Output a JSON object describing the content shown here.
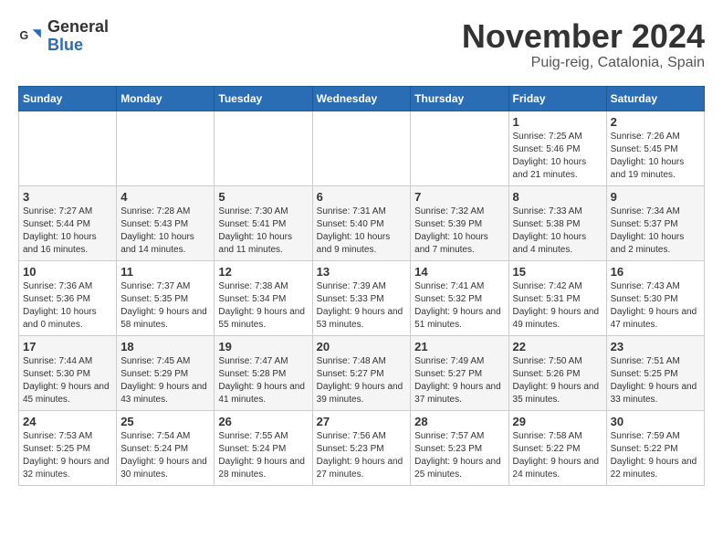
{
  "header": {
    "logo_general": "General",
    "logo_blue": "Blue",
    "month_title": "November 2024",
    "location": "Puig-reig, Catalonia, Spain"
  },
  "days_of_week": [
    "Sunday",
    "Monday",
    "Tuesday",
    "Wednesday",
    "Thursday",
    "Friday",
    "Saturday"
  ],
  "weeks": [
    [
      {
        "num": "",
        "info": ""
      },
      {
        "num": "",
        "info": ""
      },
      {
        "num": "",
        "info": ""
      },
      {
        "num": "",
        "info": ""
      },
      {
        "num": "",
        "info": ""
      },
      {
        "num": "1",
        "info": "Sunrise: 7:25 AM\nSunset: 5:46 PM\nDaylight: 10 hours and 21 minutes."
      },
      {
        "num": "2",
        "info": "Sunrise: 7:26 AM\nSunset: 5:45 PM\nDaylight: 10 hours and 19 minutes."
      }
    ],
    [
      {
        "num": "3",
        "info": "Sunrise: 7:27 AM\nSunset: 5:44 PM\nDaylight: 10 hours and 16 minutes."
      },
      {
        "num": "4",
        "info": "Sunrise: 7:28 AM\nSunset: 5:43 PM\nDaylight: 10 hours and 14 minutes."
      },
      {
        "num": "5",
        "info": "Sunrise: 7:30 AM\nSunset: 5:41 PM\nDaylight: 10 hours and 11 minutes."
      },
      {
        "num": "6",
        "info": "Sunrise: 7:31 AM\nSunset: 5:40 PM\nDaylight: 10 hours and 9 minutes."
      },
      {
        "num": "7",
        "info": "Sunrise: 7:32 AM\nSunset: 5:39 PM\nDaylight: 10 hours and 7 minutes."
      },
      {
        "num": "8",
        "info": "Sunrise: 7:33 AM\nSunset: 5:38 PM\nDaylight: 10 hours and 4 minutes."
      },
      {
        "num": "9",
        "info": "Sunrise: 7:34 AM\nSunset: 5:37 PM\nDaylight: 10 hours and 2 minutes."
      }
    ],
    [
      {
        "num": "10",
        "info": "Sunrise: 7:36 AM\nSunset: 5:36 PM\nDaylight: 10 hours and 0 minutes."
      },
      {
        "num": "11",
        "info": "Sunrise: 7:37 AM\nSunset: 5:35 PM\nDaylight: 9 hours and 58 minutes."
      },
      {
        "num": "12",
        "info": "Sunrise: 7:38 AM\nSunset: 5:34 PM\nDaylight: 9 hours and 55 minutes."
      },
      {
        "num": "13",
        "info": "Sunrise: 7:39 AM\nSunset: 5:33 PM\nDaylight: 9 hours and 53 minutes."
      },
      {
        "num": "14",
        "info": "Sunrise: 7:41 AM\nSunset: 5:32 PM\nDaylight: 9 hours and 51 minutes."
      },
      {
        "num": "15",
        "info": "Sunrise: 7:42 AM\nSunset: 5:31 PM\nDaylight: 9 hours and 49 minutes."
      },
      {
        "num": "16",
        "info": "Sunrise: 7:43 AM\nSunset: 5:30 PM\nDaylight: 9 hours and 47 minutes."
      }
    ],
    [
      {
        "num": "17",
        "info": "Sunrise: 7:44 AM\nSunset: 5:30 PM\nDaylight: 9 hours and 45 minutes."
      },
      {
        "num": "18",
        "info": "Sunrise: 7:45 AM\nSunset: 5:29 PM\nDaylight: 9 hours and 43 minutes."
      },
      {
        "num": "19",
        "info": "Sunrise: 7:47 AM\nSunset: 5:28 PM\nDaylight: 9 hours and 41 minutes."
      },
      {
        "num": "20",
        "info": "Sunrise: 7:48 AM\nSunset: 5:27 PM\nDaylight: 9 hours and 39 minutes."
      },
      {
        "num": "21",
        "info": "Sunrise: 7:49 AM\nSunset: 5:27 PM\nDaylight: 9 hours and 37 minutes."
      },
      {
        "num": "22",
        "info": "Sunrise: 7:50 AM\nSunset: 5:26 PM\nDaylight: 9 hours and 35 minutes."
      },
      {
        "num": "23",
        "info": "Sunrise: 7:51 AM\nSunset: 5:25 PM\nDaylight: 9 hours and 33 minutes."
      }
    ],
    [
      {
        "num": "24",
        "info": "Sunrise: 7:53 AM\nSunset: 5:25 PM\nDaylight: 9 hours and 32 minutes."
      },
      {
        "num": "25",
        "info": "Sunrise: 7:54 AM\nSunset: 5:24 PM\nDaylight: 9 hours and 30 minutes."
      },
      {
        "num": "26",
        "info": "Sunrise: 7:55 AM\nSunset: 5:24 PM\nDaylight: 9 hours and 28 minutes."
      },
      {
        "num": "27",
        "info": "Sunrise: 7:56 AM\nSunset: 5:23 PM\nDaylight: 9 hours and 27 minutes."
      },
      {
        "num": "28",
        "info": "Sunrise: 7:57 AM\nSunset: 5:23 PM\nDaylight: 9 hours and 25 minutes."
      },
      {
        "num": "29",
        "info": "Sunrise: 7:58 AM\nSunset: 5:22 PM\nDaylight: 9 hours and 24 minutes."
      },
      {
        "num": "30",
        "info": "Sunrise: 7:59 AM\nSunset: 5:22 PM\nDaylight: 9 hours and 22 minutes."
      }
    ]
  ]
}
